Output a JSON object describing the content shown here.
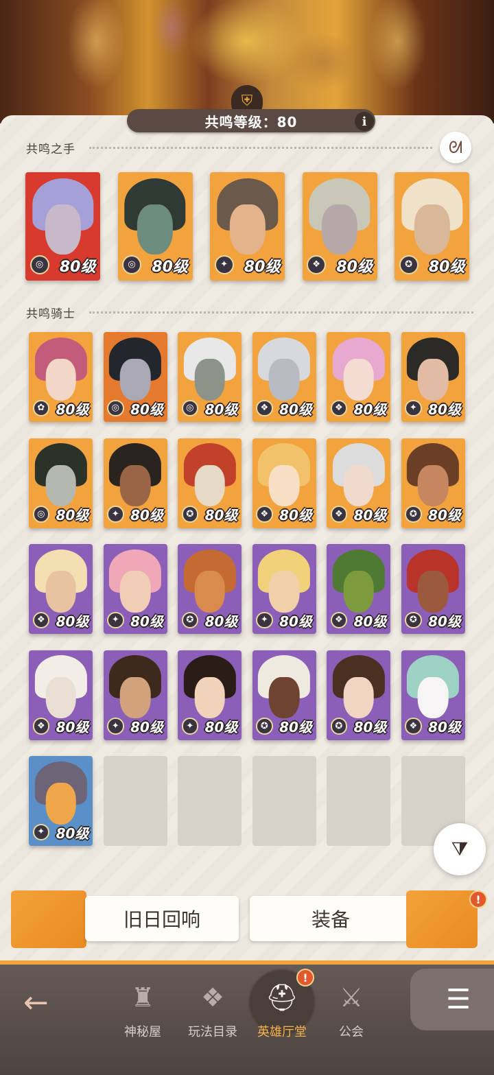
{
  "header": {
    "level_text": "共鸣等级：80",
    "info_icon": "i",
    "crest_icon": "helmet-crest"
  },
  "sections": {
    "hands_title": "共鸣之手",
    "knights_title": "共鸣骑士"
  },
  "hands": [
    {
      "level": "80级",
      "class_icon": "◎",
      "bg": "#d83a2e",
      "hair": "#a6a0d8",
      "face": "#c7b9c9"
    },
    {
      "level": "80级",
      "class_icon": "◎",
      "bg": "#f2a33d",
      "hair": "#2f3a34",
      "face": "#6c8c7e"
    },
    {
      "level": "80级",
      "class_icon": "✦",
      "bg": "#f2a33d",
      "hair": "#6b5a4c",
      "face": "#e3b38c"
    },
    {
      "level": "80级",
      "class_icon": "❖",
      "bg": "#f2a33d",
      "hair": "#c9c8b8",
      "face": "#b6a8a8"
    },
    {
      "level": "80级",
      "class_icon": "✪",
      "bg": "#f2a33d",
      "hair": "#efe2c8",
      "face": "#d9b89a"
    }
  ],
  "knights": [
    {
      "level": "80级",
      "class_icon": "✿",
      "bg": "#f2a33d",
      "hair": "#c25c7a",
      "face": "#f2d6c8"
    },
    {
      "level": "80级",
      "class_icon": "◎",
      "bg": "#e57a2e",
      "hair": "#24262d",
      "face": "#a9a8b4"
    },
    {
      "level": "80级",
      "class_icon": "◎",
      "bg": "#f2a33d",
      "hair": "#e8e8e8",
      "face": "#8c948a"
    },
    {
      "level": "80级",
      "class_icon": "❖",
      "bg": "#f2a33d",
      "hair": "#d7d9dd",
      "face": "#b8bcc2"
    },
    {
      "level": "80级",
      "class_icon": "❖",
      "bg": "#f2a33d",
      "hair": "#e7a9cf",
      "face": "#f5dcd2"
    },
    {
      "level": "80级",
      "class_icon": "✦",
      "bg": "#f2a33d",
      "hair": "#2b2a26",
      "face": "#e2bba4"
    },
    {
      "level": "80级",
      "class_icon": "◎",
      "bg": "#f2a33d",
      "hair": "#2b3228",
      "face": "#b5b8b0"
    },
    {
      "level": "80级",
      "class_icon": "✦",
      "bg": "#f2a33d",
      "hair": "#2a2420",
      "face": "#9a6546"
    },
    {
      "level": "80级",
      "class_icon": "✪",
      "bg": "#f2a33d",
      "hair": "#c2412a",
      "face": "#e6d9c6"
    },
    {
      "level": "80级",
      "class_icon": "❖",
      "bg": "#f2a33d",
      "hair": "#f2c26b",
      "face": "#f6dfc4"
    },
    {
      "level": "80级",
      "class_icon": "❖",
      "bg": "#f2a33d",
      "hair": "#dcdcdc",
      "face": "#f0dacd"
    },
    {
      "level": "80级",
      "class_icon": "✪",
      "bg": "#f2a33d",
      "hair": "#6a3f25",
      "face": "#c58660"
    },
    {
      "level": "80级",
      "class_icon": "❖",
      "bg": "#8b5fb8",
      "hair": "#f2dfb2",
      "face": "#e8c3a2"
    },
    {
      "level": "80级",
      "class_icon": "✦",
      "bg": "#8b5fb8",
      "hair": "#f0a7b8",
      "face": "#f2cdb6"
    },
    {
      "level": "80级",
      "class_icon": "✪",
      "bg": "#8b5fb8",
      "hair": "#c46a32",
      "face": "#d98b4e"
    },
    {
      "level": "80级",
      "class_icon": "✦",
      "bg": "#8b5fb8",
      "hair": "#f1d17a",
      "face": "#f1cfa9"
    },
    {
      "level": "80级",
      "class_icon": "❖",
      "bg": "#8b5fb8",
      "hair": "#4f7a33",
      "face": "#7d9a3c"
    },
    {
      "level": "80级",
      "class_icon": "✪",
      "bg": "#8b5fb8",
      "hair": "#b8332a",
      "face": "#9b5a3e"
    },
    {
      "level": "80级",
      "class_icon": "❖",
      "bg": "#8b5fb8",
      "hair": "#f2ede6",
      "face": "#e9dfd5"
    },
    {
      "level": "80级",
      "class_icon": "✦",
      "bg": "#8b5fb8",
      "hair": "#3d2a1c",
      "face": "#d2a27c"
    },
    {
      "level": "80级",
      "class_icon": "✦",
      "bg": "#8b5fb8",
      "hair": "#2a1c16",
      "face": "#f1d3b9"
    },
    {
      "level": "80级",
      "class_icon": "✪",
      "bg": "#8b5fb8",
      "hair": "#eeeadf",
      "face": "#6e4331"
    },
    {
      "level": "80级",
      "class_icon": "✪",
      "bg": "#8b5fb8",
      "hair": "#4a3021",
      "face": "#f2d4c2"
    },
    {
      "level": "80级",
      "class_icon": "❖",
      "bg": "#8b5fb8",
      "hair": "#9ed2c4",
      "face": "#f6f4f4"
    },
    {
      "level": "80级",
      "class_icon": "✦",
      "bg": "#5b8fc8",
      "hair": "#6d6478",
      "face": "#f0a64a"
    }
  ],
  "empty_slots": 5,
  "actions": {
    "echo_label": "旧日回响",
    "equip_label": "装备",
    "equip_alert": "!"
  },
  "nav": {
    "back_icon": "←",
    "items": [
      {
        "label": "神秘屋",
        "icon": "♜"
      },
      {
        "label": "玩法目录",
        "icon": "❖"
      },
      {
        "label": "英雄厅堂",
        "icon": "⛑",
        "alert": "!"
      },
      {
        "label": "公会",
        "icon": "⚔"
      }
    ],
    "menu_icon": "☰"
  },
  "colors": {
    "accent": "#f0a23b",
    "panel": "#ece7dd",
    "nav_bg": "#574c48"
  }
}
